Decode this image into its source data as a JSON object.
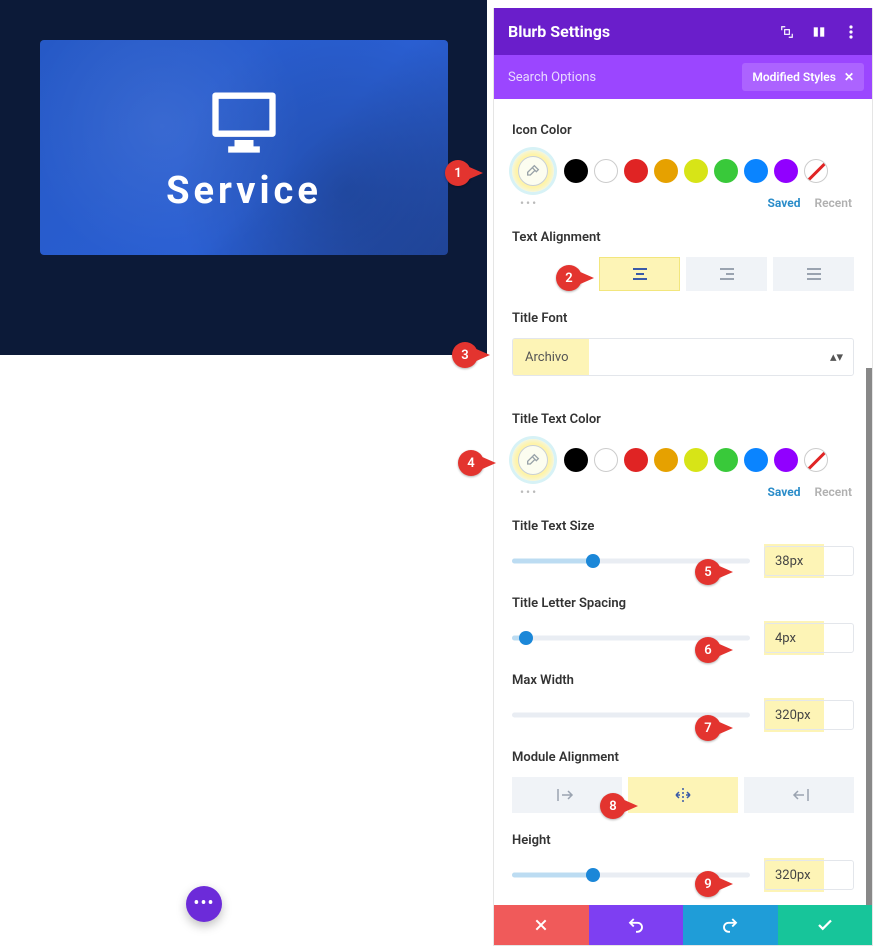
{
  "preview": {
    "card_title": "Service"
  },
  "panel": {
    "title": "Blurb Settings",
    "subheader": {
      "search": "Search Options",
      "modified": "Modified Styles",
      "close_glyph": "✕"
    }
  },
  "sections": {
    "icon_color": {
      "label": "Icon Color",
      "saved": "Saved",
      "recent": "Recent"
    },
    "text_alignment": {
      "label": "Text Alignment"
    },
    "title_font": {
      "label": "Title Font",
      "value": "Archivo"
    },
    "title_text_color": {
      "label": "Title Text Color",
      "saved": "Saved",
      "recent": "Recent"
    },
    "title_text_size": {
      "label": "Title Text Size",
      "value": "38px",
      "percent": 34
    },
    "title_letter_spacing": {
      "label": "Title Letter Spacing",
      "value": "4px",
      "percent": 6
    },
    "max_width": {
      "label": "Max Width",
      "value": "320px",
      "percent": 0
    },
    "module_alignment": {
      "label": "Module Alignment"
    },
    "height": {
      "label": "Height",
      "value": "320px",
      "percent": 34
    }
  },
  "callouts": [
    "1",
    "2",
    "3",
    "4",
    "5",
    "6",
    "7",
    "8",
    "9"
  ],
  "colors": {
    "swatches": [
      "black",
      "white",
      "red",
      "orange",
      "yellow",
      "green",
      "blue",
      "purple",
      "striped"
    ]
  }
}
